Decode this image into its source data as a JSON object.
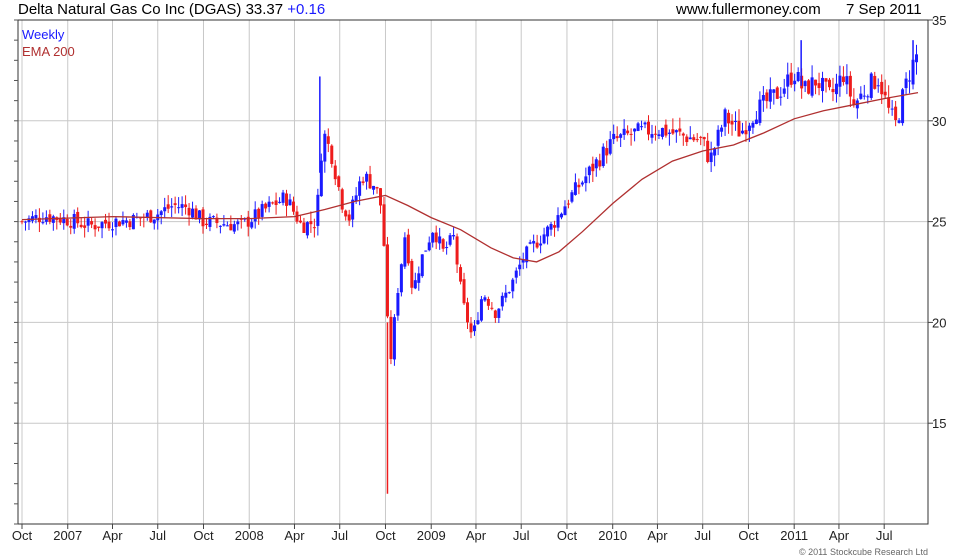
{
  "header": {
    "title": "Delta Natural Gas Co Inc (DGAS) 33.37",
    "change": "+0.16",
    "site": "www.fullermoney.com",
    "date": "7 Sep 2011"
  },
  "legend": {
    "weekly": "Weekly",
    "ema": "EMA 200"
  },
  "credit": "© 2011 Stockcube Research Ltd",
  "colors": {
    "up": "#1a1aff",
    "down": "#ee1c1c",
    "ema": "#b03030",
    "grid": "#c8c8c8"
  },
  "chart_data": {
    "type": "candlestick",
    "title": "Delta Natural Gas Co Inc (DGAS)",
    "interval": "Weekly",
    "ylim": [
      10,
      35
    ],
    "yticks": [
      15,
      20,
      25,
      30,
      35
    ],
    "xlim": [
      "2006-10-01",
      "2011-09-07"
    ],
    "xticks": [
      {
        "label": "Oct",
        "date": "2006-10-01"
      },
      {
        "label": "2007",
        "date": "2007-01-01"
      },
      {
        "label": "Apr",
        "date": "2007-04-01"
      },
      {
        "label": "Jul",
        "date": "2007-07-01"
      },
      {
        "label": "Oct",
        "date": "2007-10-01"
      },
      {
        "label": "2008",
        "date": "2008-01-01"
      },
      {
        "label": "Apr",
        "date": "2008-04-01"
      },
      {
        "label": "Jul",
        "date": "2008-07-01"
      },
      {
        "label": "Oct",
        "date": "2008-10-01"
      },
      {
        "label": "2009",
        "date": "2009-01-01"
      },
      {
        "label": "Apr",
        "date": "2009-04-01"
      },
      {
        "label": "Jul",
        "date": "2009-07-01"
      },
      {
        "label": "Oct",
        "date": "2009-10-01"
      },
      {
        "label": "2010",
        "date": "2010-01-01"
      },
      {
        "label": "Apr",
        "date": "2010-04-01"
      },
      {
        "label": "Jul",
        "date": "2010-07-01"
      },
      {
        "label": "Oct",
        "date": "2010-10-01"
      },
      {
        "label": "2011",
        "date": "2011-01-01"
      },
      {
        "label": "Apr",
        "date": "2011-04-01"
      },
      {
        "label": "Jul",
        "date": "2011-07-01"
      }
    ],
    "series": [
      {
        "name": "Weekly",
        "kind": "close_path",
        "points": [
          [
            "2006-10-01",
            25.0
          ],
          [
            "2006-11-15",
            25.3
          ],
          [
            "2007-01-01",
            25.1
          ],
          [
            "2007-02-15",
            24.8
          ],
          [
            "2007-04-01",
            25.0
          ],
          [
            "2007-05-15",
            25.1
          ],
          [
            "2007-07-01",
            25.4
          ],
          [
            "2007-08-01",
            25.8
          ],
          [
            "2007-09-01",
            25.7
          ],
          [
            "2007-10-01",
            25.0
          ],
          [
            "2007-11-15",
            24.9
          ],
          [
            "2007-12-15",
            24.8
          ],
          [
            "2008-01-15",
            25.3
          ],
          [
            "2008-02-15",
            25.8
          ],
          [
            "2008-03-15",
            26.2
          ],
          [
            "2008-04-15",
            24.8
          ],
          [
            "2008-05-15",
            25.0
          ],
          [
            "2008-05-28",
            29.5
          ],
          [
            "2008-06-15",
            28.3
          ],
          [
            "2008-07-05",
            26.0
          ],
          [
            "2008-07-20",
            25.2
          ],
          [
            "2008-08-15",
            27.3
          ],
          [
            "2008-09-10",
            26.8
          ],
          [
            "2008-09-25",
            25.5
          ],
          [
            "2008-10-05",
            20.0
          ],
          [
            "2008-10-12",
            18.3
          ],
          [
            "2008-10-25",
            21.5
          ],
          [
            "2008-11-10",
            24.5
          ],
          [
            "2008-11-25",
            21.5
          ],
          [
            "2008-12-10",
            23.0
          ],
          [
            "2009-01-05",
            24.7
          ],
          [
            "2009-01-25",
            23.5
          ],
          [
            "2009-02-15",
            24.2
          ],
          [
            "2009-03-05",
            21.0
          ],
          [
            "2009-03-25",
            19.2
          ],
          [
            "2009-04-15",
            21.5
          ],
          [
            "2009-05-10",
            20.5
          ],
          [
            "2009-06-10",
            21.8
          ],
          [
            "2009-07-05",
            23.2
          ],
          [
            "2009-08-01",
            24.0
          ],
          [
            "2009-09-01",
            24.8
          ],
          [
            "2009-10-01",
            26.0
          ],
          [
            "2009-11-01",
            27.0
          ],
          [
            "2009-12-01",
            28.0
          ],
          [
            "2010-01-01",
            29.0
          ],
          [
            "2010-02-15",
            29.4
          ],
          [
            "2010-04-01",
            29.6
          ],
          [
            "2010-05-15",
            29.3
          ],
          [
            "2010-07-01",
            29.0
          ],
          [
            "2010-07-15",
            28.0
          ],
          [
            "2010-08-15",
            30.2
          ],
          [
            "2010-09-15",
            29.4
          ],
          [
            "2010-10-15",
            30.5
          ],
          [
            "2010-12-01",
            31.4
          ],
          [
            "2011-01-01",
            32.4
          ],
          [
            "2011-01-20",
            31.5
          ],
          [
            "2011-02-15",
            32.0
          ],
          [
            "2011-03-15",
            31.2
          ],
          [
            "2011-04-10",
            32.3
          ],
          [
            "2011-05-01",
            30.8
          ],
          [
            "2011-06-01",
            31.8
          ],
          [
            "2011-06-20",
            32.1
          ],
          [
            "2011-07-10",
            30.5
          ],
          [
            "2011-07-25",
            29.8
          ],
          [
            "2011-08-10",
            31.5
          ],
          [
            "2011-08-25",
            32.7
          ],
          [
            "2011-09-07",
            33.37
          ]
        ]
      },
      {
        "name": "EMA 200",
        "kind": "line",
        "points": [
          [
            "2006-10-01",
            25.1
          ],
          [
            "2007-04-01",
            25.25
          ],
          [
            "2007-10-01",
            25.15
          ],
          [
            "2008-01-01",
            25.15
          ],
          [
            "2008-04-01",
            25.25
          ],
          [
            "2008-06-01",
            25.6
          ],
          [
            "2008-08-01",
            26.0
          ],
          [
            "2008-10-01",
            26.3
          ],
          [
            "2008-11-15",
            25.8
          ],
          [
            "2009-01-01",
            25.2
          ],
          [
            "2009-03-01",
            24.6
          ],
          [
            "2009-05-01",
            23.7
          ],
          [
            "2009-06-15",
            23.2
          ],
          [
            "2009-08-01",
            23.0
          ],
          [
            "2009-09-15",
            23.5
          ],
          [
            "2009-11-01",
            24.5
          ],
          [
            "2010-01-01",
            25.9
          ],
          [
            "2010-03-01",
            27.1
          ],
          [
            "2010-05-01",
            28.0
          ],
          [
            "2010-07-01",
            28.5
          ],
          [
            "2010-09-01",
            28.8
          ],
          [
            "2010-11-01",
            29.4
          ],
          [
            "2011-01-01",
            30.1
          ],
          [
            "2011-03-01",
            30.5
          ],
          [
            "2011-05-01",
            30.8
          ],
          [
            "2011-07-01",
            31.1
          ],
          [
            "2011-09-07",
            31.4
          ]
        ]
      }
    ],
    "annotations": [
      {
        "type": "spike_low",
        "date": "2008-10-05",
        "low": 11.5
      },
      {
        "type": "spike_high",
        "date": "2008-05-22",
        "high": 32.2
      },
      {
        "type": "spike_high",
        "date": "2011-01-15",
        "high": 34.0
      },
      {
        "type": "spike_high",
        "date": "2011-08-28",
        "high": 34.0
      }
    ]
  }
}
